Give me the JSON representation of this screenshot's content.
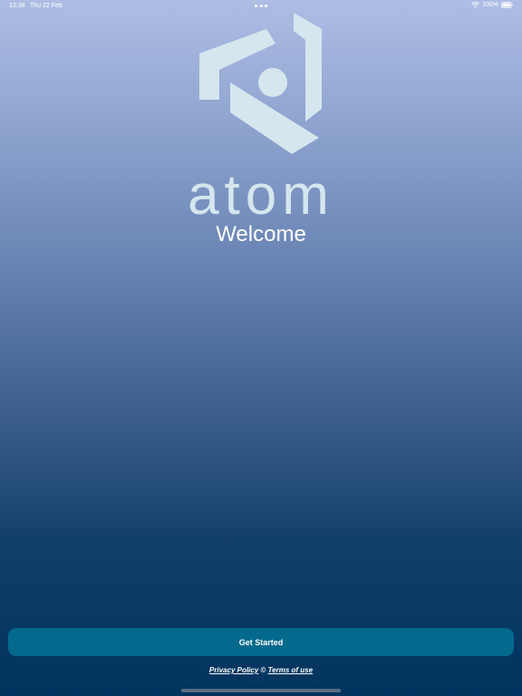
{
  "status_bar": {
    "time": "13:38",
    "date": "Thu 22 Feb",
    "battery": "100%"
  },
  "brand": {
    "name": "atom",
    "color": "#d5e6ee"
  },
  "welcome": {
    "title": "Welcome"
  },
  "actions": {
    "get_started_label": "Get Started",
    "button_color": "#03698d"
  },
  "legal": {
    "privacy_label": "Privacy Policy",
    "separator": "©",
    "terms_label": "Terms of use"
  },
  "icons": [
    "wifi-icon",
    "battery-icon",
    "atom-logo-icon"
  ]
}
